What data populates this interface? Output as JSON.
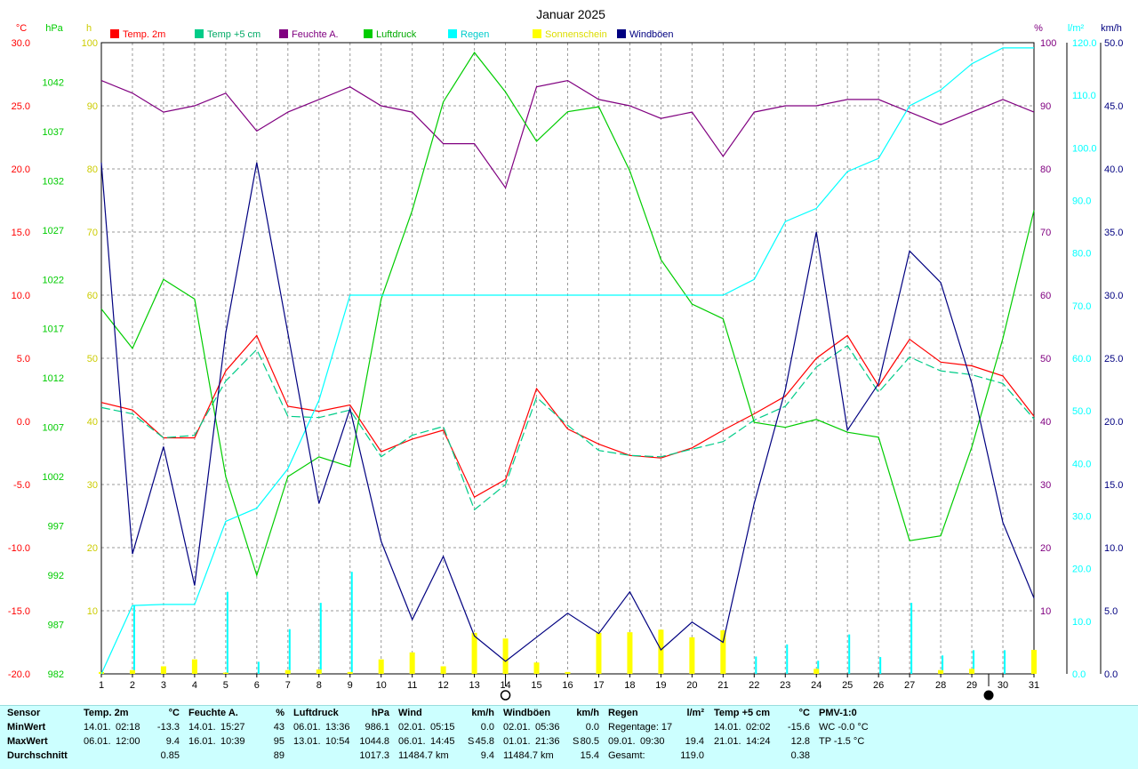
{
  "chart_data": {
    "type": "line",
    "title": "Januar 2025",
    "x": [
      1,
      2,
      3,
      4,
      5,
      6,
      7,
      8,
      9,
      10,
      11,
      12,
      13,
      14,
      15,
      16,
      17,
      18,
      19,
      20,
      21,
      22,
      23,
      24,
      25,
      26,
      27,
      28,
      29,
      30,
      31
    ],
    "axes": {
      "temp": {
        "unit": "°C",
        "range": [
          -20,
          30
        ],
        "ticks": [
          "-20.0",
          "-15.0",
          "-10.0",
          "-5.0",
          "0.0",
          "5.0",
          "10.0",
          "15.0",
          "20.0",
          "25.0",
          "30.0"
        ],
        "color": "#ff0000"
      },
      "pressure": {
        "unit": "hPa",
        "range": [
          982,
          1046
        ],
        "ticks": [
          "982",
          "987",
          "992",
          "997",
          "1002",
          "1007",
          "1012",
          "1017",
          "1022",
          "1027",
          "1032",
          "1037",
          "1042"
        ],
        "color": "#00cc00"
      },
      "sunshine": {
        "unit": "h",
        "range": [
          0,
          100
        ],
        "ticks": [
          "10",
          "20",
          "30",
          "40",
          "50",
          "60",
          "70",
          "80",
          "90",
          "100"
        ],
        "color": "#cccc00"
      },
      "humidity": {
        "unit": "%",
        "range": [
          0,
          100
        ],
        "ticks": [
          "10",
          "20",
          "30",
          "40",
          "50",
          "60",
          "70",
          "80",
          "90",
          "100"
        ],
        "color": "#800080"
      },
      "rain": {
        "unit": "l/m²",
        "range": [
          0,
          120
        ],
        "ticks": [
          "0.0",
          "10.0",
          "20.0",
          "30.0",
          "40.0",
          "50.0",
          "60.0",
          "70.0",
          "80.0",
          "90.0",
          "100.0",
          "110.0",
          "120.0"
        ],
        "color": "#00ffff"
      },
      "wind": {
        "unit": "km/h",
        "range": [
          0,
          50
        ],
        "ticks": [
          "0.0",
          "5.0",
          "10.0",
          "15.0",
          "20.0",
          "25.0",
          "30.0",
          "35.0",
          "40.0",
          "45.0",
          "50.0"
        ],
        "color": "#000080"
      }
    },
    "grid": true,
    "legend_position": "top",
    "series": [
      {
        "name": "Temp. 2m",
        "axis": "temp",
        "color": "#ff0000",
        "dash": false,
        "values": [
          1.5,
          0.9,
          -1.3,
          -1.3,
          4.0,
          6.8,
          1.2,
          0.8,
          1.3,
          -2.4,
          -1.4,
          -0.7,
          -6.0,
          -4.6,
          2.6,
          -0.6,
          -1.8,
          -2.7,
          -2.9,
          -2.1,
          -0.7,
          0.6,
          2.0,
          5.0,
          6.8,
          2.8,
          6.5,
          4.7,
          4.4,
          3.6,
          0.4
        ]
      },
      {
        "name": "Temp +5 cm",
        "axis": "temp",
        "color": "#00cc88",
        "dash": true,
        "values": [
          1.1,
          0.6,
          -1.3,
          -1.1,
          3.2,
          5.7,
          0.4,
          0.3,
          0.9,
          -2.8,
          -1.1,
          -0.4,
          -7.0,
          -5.0,
          1.9,
          -0.3,
          -2.3,
          -2.7,
          -2.8,
          -2.2,
          -1.6,
          0.1,
          1.2,
          4.3,
          6.0,
          2.3,
          5.1,
          4.0,
          3.7,
          3.0,
          0.2
        ]
      },
      {
        "name": "Feuchte A.",
        "axis": "humidity",
        "color": "#800080",
        "dash": false,
        "values": [
          94,
          92,
          89,
          90,
          92,
          86,
          89,
          91,
          93,
          90,
          89,
          84,
          84,
          77,
          93,
          94,
          91,
          90,
          88,
          89,
          82,
          89,
          90,
          90,
          91,
          91,
          89,
          87,
          89,
          91,
          89
        ]
      },
      {
        "name": "Luftdruck",
        "axis": "pressure",
        "color": "#00cc00",
        "dash": false,
        "values": [
          1019,
          1015,
          1022,
          1020,
          1002,
          992,
          1002,
          1004,
          1003,
          1020,
          1029,
          1040,
          1045,
          1041,
          1036,
          1039,
          1039.5,
          1033,
          1024,
          1019.5,
          1018,
          1007.5,
          1007,
          1007.8,
          1006.5,
          1006,
          995.5,
          996,
          1005,
          1016,
          1029
        ]
      },
      {
        "name": "Regen",
        "axis": "rain",
        "color": "#00ffff",
        "dash": false,
        "values": [
          0,
          13,
          13.2,
          13.2,
          29,
          31.5,
          39,
          52,
          72,
          72,
          72,
          72,
          72,
          72,
          72,
          72,
          72,
          72,
          72,
          72,
          72,
          75,
          86,
          88.5,
          95.5,
          98,
          108,
          111,
          116,
          119,
          119
        ]
      },
      {
        "name": "Sonnenschein",
        "axis": "sunshine",
        "color": "#ffff00",
        "dash": false,
        "bars": true,
        "values": [
          0.3,
          0.6,
          1.2,
          2.3,
          0.2,
          0,
          0.6,
          0.7,
          0.3,
          2.3,
          3.4,
          1.2,
          6.5,
          5.6,
          1.8,
          0.3,
          6.5,
          6.6,
          7.0,
          5.8,
          6.9,
          0,
          0,
          0.8,
          0,
          0,
          0,
          0.6,
          0.8,
          0,
          3.8
        ]
      },
      {
        "name": "Windböen",
        "axis": "wind",
        "color": "#000080",
        "dash": false,
        "values": [
          40.5,
          9.5,
          18.0,
          7.0,
          27.0,
          40.5,
          27.0,
          13.5,
          21.0,
          10.5,
          4.3,
          9.3,
          3.0,
          1.0,
          2.9,
          4.8,
          3.2,
          6.5,
          1.9,
          4.1,
          2.5,
          13.5,
          22.5,
          35.0,
          19.3,
          23.0,
          33.5,
          31.0,
          23.0,
          12.0,
          6.0
        ]
      }
    ],
    "rain_bars": {
      "axis": "rain",
      "color": "#00ffff",
      "values": [
        0,
        13,
        0.2,
        0,
        15.6,
        2.3,
        8.5,
        13.5,
        19.4,
        0,
        0,
        0,
        0,
        0,
        0,
        0,
        0,
        0,
        0,
        0,
        0,
        3.3,
        5.6,
        2.5,
        7.5,
        3.2,
        13.5,
        3.5,
        4.5,
        4.5,
        0
      ]
    },
    "markers": {
      "new_moon_day": 30,
      "full_moon_day": 14
    }
  },
  "legend": [
    {
      "label": "Temp. 2m",
      "color": "#ff0000",
      "text_color": "#ff0000"
    },
    {
      "label": "Temp +5 cm",
      "color": "#00cc88",
      "text_color": "#00aa66"
    },
    {
      "label": "Feuchte A.",
      "color": "#800080",
      "text_color": "#800080"
    },
    {
      "label": "Luftdruck",
      "color": "#00cc00",
      "text_color": "#00aa00"
    },
    {
      "label": "Regen",
      "color": "#00ffff",
      "text_color": "#00cccc"
    },
    {
      "label": "Sonnenschein",
      "color": "#ffff00",
      "text_color": "#dddd00"
    },
    {
      "label": "Windböen",
      "color": "#000080",
      "text_color": "#000080"
    }
  ],
  "stats": {
    "sensor": {
      "header": "Sensor",
      "rows": [
        "MinWert",
        "MaxWert",
        "Durchschnitt"
      ]
    },
    "blocks": [
      {
        "name": "Temp. 2m",
        "unit": "°C",
        "rows": [
          [
            "14.01.",
            "02:18",
            "",
            "-13.3"
          ],
          [
            "06.01.",
            "12:00",
            "",
            "9.4"
          ],
          [
            "",
            "",
            "",
            "0.85"
          ]
        ]
      },
      {
        "name": "Feuchte A.",
        "unit": "%",
        "rows": [
          [
            "14.01.",
            "15:27",
            "",
            "43"
          ],
          [
            "16.01.",
            "10:39",
            "",
            "95"
          ],
          [
            "",
            "",
            "",
            "89"
          ]
        ]
      },
      {
        "name": "Luftdruck",
        "unit": "hPa",
        "rows": [
          [
            "06.01.",
            "13:36",
            "",
            "986.1"
          ],
          [
            "13.01.",
            "10:54",
            "",
            "1044.8"
          ],
          [
            "",
            "",
            "",
            "1017.3"
          ]
        ]
      },
      {
        "name": "Wind",
        "unit": "km/h",
        "rows": [
          [
            "02.01.",
            "05:15",
            "",
            "0.0"
          ],
          [
            "06.01.",
            "14:45",
            "S",
            "45.8"
          ],
          [
            "11484.7 km",
            "",
            "",
            "9.4"
          ]
        ]
      },
      {
        "name": "Windböen",
        "unit": "km/h",
        "rows": [
          [
            "02.01.",
            "05:36",
            "",
            "0.0"
          ],
          [
            "01.01.",
            "21:36",
            "S",
            "80.5"
          ],
          [
            "11484.7 km",
            "",
            "",
            "15.4"
          ]
        ]
      },
      {
        "name": "Regen",
        "unit": "l/m²",
        "rows": [
          [
            "Regentage: 17",
            "",
            "",
            ""
          ],
          [
            "09.01.",
            "09:30",
            "",
            "19.4"
          ],
          [
            "Gesamt:",
            "",
            "",
            "119.0"
          ]
        ]
      },
      {
        "name": "Temp +5 cm",
        "unit": "°C",
        "rows": [
          [
            "14.01.",
            "02:02",
            "",
            "-15.6"
          ],
          [
            "21.01.",
            "14:24",
            "",
            "12.8"
          ],
          [
            "",
            "",
            "",
            "0.38"
          ]
        ]
      },
      {
        "name": "PMV-1:0",
        "unit": "",
        "rows": [
          [
            "WC -0.0 °C",
            "",
            "",
            ""
          ],
          [
            "TP -1.5 °C",
            "",
            "",
            ""
          ],
          [
            "",
            "",
            "",
            ""
          ]
        ]
      }
    ]
  }
}
